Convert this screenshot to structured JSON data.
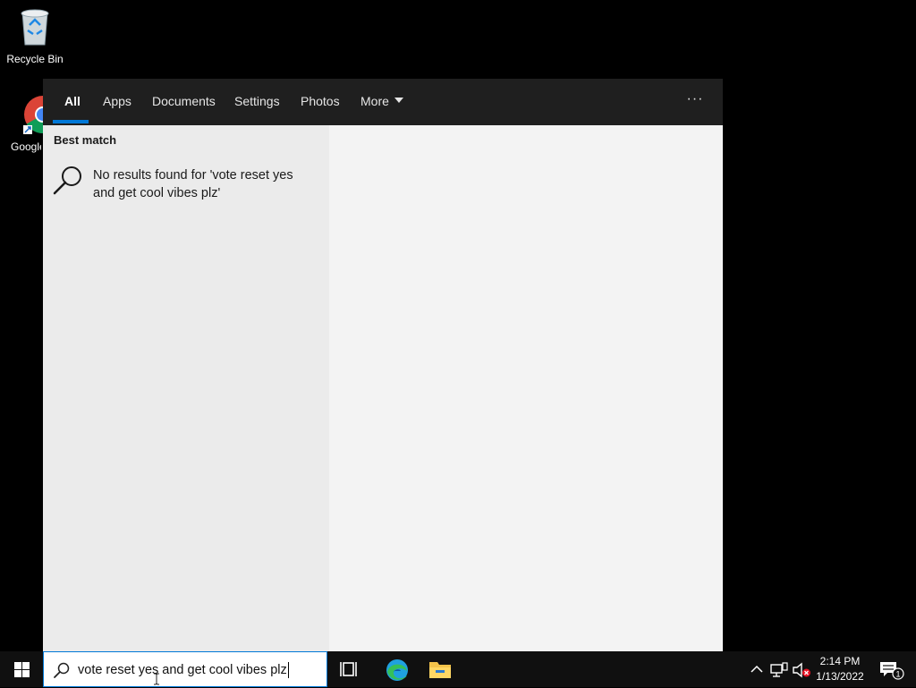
{
  "desktop": {
    "icons": [
      {
        "label": "Recycle Bin",
        "icon": "recycle-bin-icon"
      },
      {
        "label": "Google Chrome",
        "icon": "chrome-icon"
      }
    ]
  },
  "search_flyout": {
    "tabs": [
      {
        "label": "All",
        "active": true
      },
      {
        "label": "Apps"
      },
      {
        "label": "Documents"
      },
      {
        "label": "Settings"
      },
      {
        "label": "Photos"
      },
      {
        "label": "More",
        "icon": "caret-down-icon"
      }
    ],
    "options_label": "···",
    "best_match_heading": "Best match",
    "no_results_text": "No results found for 'vote reset yes and get cool vibes plz'"
  },
  "taskbar": {
    "search_query": "vote reset yes and get cool vibes plz",
    "pinned": [
      "task-view-icon",
      "edge-icon",
      "file-explorer-icon"
    ],
    "clock": {
      "time": "2:14 PM",
      "date": "1/13/2022"
    },
    "notification_count": "1"
  },
  "colors": {
    "accent": "#0078d7",
    "flyout_header": "#1f1f1f",
    "left_pane": "#ebebeb",
    "right_pane": "#f3f3f3",
    "taskbar": "#101010"
  }
}
